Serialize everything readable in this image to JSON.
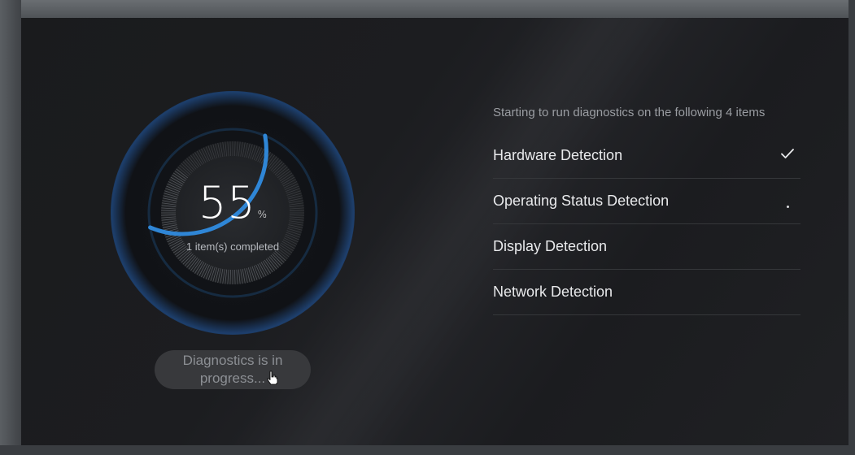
{
  "progress": {
    "percent": "55",
    "percent_unit": "%",
    "fraction": 0.55,
    "completed_text": "1 item(s) completed",
    "status_button": "Diagnostics is in progress..."
  },
  "diagnostics": {
    "intro": "Starting to run diagnostics on the following 4 items",
    "items": [
      {
        "label": "Hardware Detection",
        "state": "done",
        "icon": "check-icon"
      },
      {
        "label": "Operating Status Detection",
        "state": "running",
        "icon": "dot-icon"
      },
      {
        "label": "Display Detection",
        "state": "pending"
      },
      {
        "label": "Network Detection",
        "state": "pending"
      }
    ]
  },
  "colors": {
    "accent": "#2f86d6",
    "background": "#1c1d20",
    "text": "#e9eaec",
    "muted": "#9a9da2"
  }
}
